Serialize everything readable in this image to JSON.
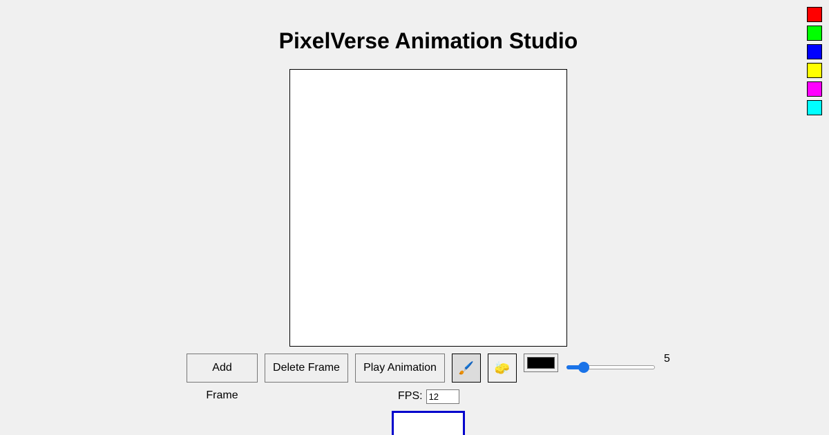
{
  "app": {
    "title": "PixelVerse Animation Studio"
  },
  "palette": {
    "colors": [
      "#ff0000",
      "#00ff00",
      "#0000ff",
      "#ffff00",
      "#ff00ff",
      "#00ffff"
    ]
  },
  "toolbar": {
    "add_frame_label": "Add Frame",
    "delete_frame_label": "Delete Frame",
    "play_animation_label": "Play Animation",
    "brush_icon": "🖌️",
    "eraser_icon": "🧽",
    "current_color": "#000000",
    "brush_size_value": "5",
    "brush_size_min": 1,
    "brush_size_max": 50
  },
  "playback": {
    "fps_label": "FPS:",
    "fps_value": "12"
  },
  "frames": {
    "selected_index": 0,
    "count": 1
  }
}
